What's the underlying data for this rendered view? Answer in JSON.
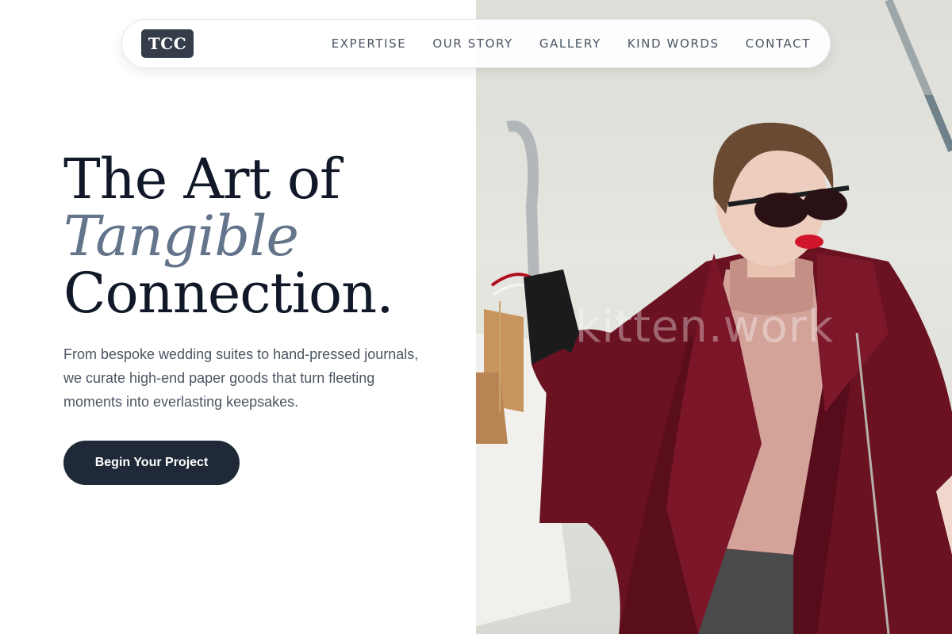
{
  "nav": {
    "logo_text": "TCC",
    "items": [
      {
        "label": "EXPERTISE"
      },
      {
        "label": "OUR STORY"
      },
      {
        "label": "GALLERY"
      },
      {
        "label": "KIND WORDS"
      },
      {
        "label": "CONTACT"
      }
    ]
  },
  "hero": {
    "title_line1": "The Art of",
    "title_line2": "Tangible",
    "title_line3": "Connection.",
    "description": "From bespoke wedding suites to hand-pressed journals, we curate high-end paper goods that turn fleeting moments into everlasting keepsakes.",
    "cta_label": "Begin Your Project"
  },
  "photo": {
    "watermark": "kitten.work"
  },
  "colors": {
    "primary_dark": "#1f2937",
    "accent_italic": "#64748b",
    "coat": "#6b1222"
  }
}
